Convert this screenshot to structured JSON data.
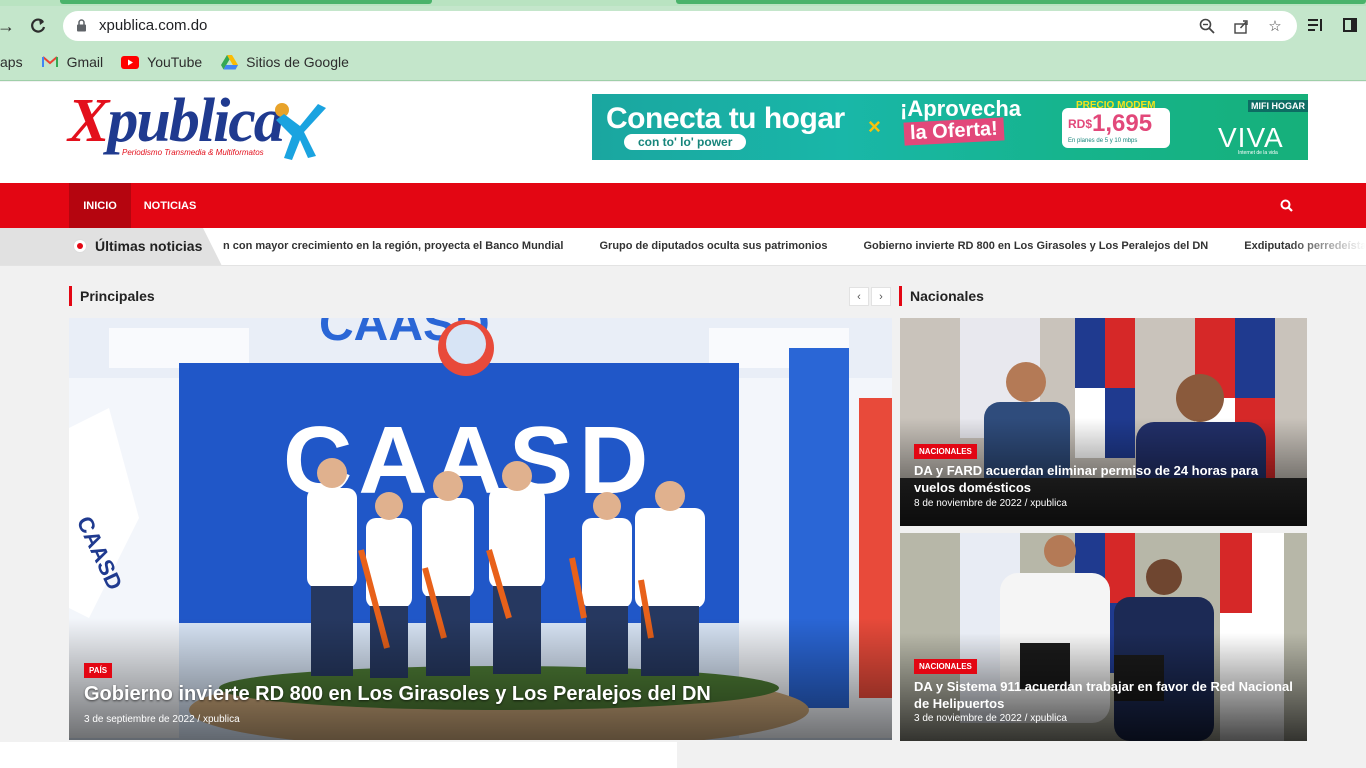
{
  "browser": {
    "url": "xpublica.com.do",
    "bookmarks": [
      {
        "label": "aps",
        "icon": "apps-icon"
      },
      {
        "label": "Gmail",
        "icon": "gmail-icon"
      },
      {
        "label": "YouTube",
        "icon": "youtube-icon"
      },
      {
        "label": "Sitios de Google",
        "icon": "google-drive-icon"
      }
    ]
  },
  "site": {
    "logo_x": "X",
    "logo_rest": "publica",
    "tagline": "Periodismo Transmedia & Multiformatos"
  },
  "ad": {
    "line1": "Conecta tu hogar",
    "line1_sub": "con to' lo' power",
    "line2": "¡Aprovecha",
    "line2b": "la Oferta!",
    "precio_label": "PRECIO MODEM",
    "currency": "RD$",
    "price": "1,695",
    "fine": "En planes de 5 y 10 mbps",
    "mifi": "MIFI HOGAR",
    "brand": "VIVA",
    "brand_sub": "Internet de la vida"
  },
  "nav": {
    "items": [
      "INICIO",
      "NOTICIAS"
    ],
    "active": "INICIO"
  },
  "ticker": {
    "label": "Últimas noticias",
    "items": [
      "n con mayor crecimiento en la región, proyecta el Banco Mundial",
      "Grupo de diputados oculta sus patrimonios",
      "Gobierno invierte RD 800 en Los Girasoles y Los Peralejos del DN",
      "Exdiputado perredeísta sa"
    ]
  },
  "principales": {
    "title": "Principales",
    "hero": {
      "category": "PAÍS",
      "title": "Gobierno invierte RD 800 en Los Girasoles y Los Peralejos del DN",
      "meta": "3 de septiembre de 2022 / xpublica",
      "sign_main": "CAASD",
      "sign_top": "CAASD",
      "flag_text": "CAASD"
    }
  },
  "nacionales": {
    "title": "Nacionales",
    "cards": [
      {
        "category": "NACIONALES",
        "title": "DA y FARD acuerdan eliminar permiso de 24 horas para vuelos domésticos",
        "meta": "8 de noviembre de 2022 / xpublica"
      },
      {
        "category": "NACIONALES",
        "title": "DA y Sistema 911 acuerdan trabajar en favor de Red Nacional de Helipuertos",
        "meta": "3 de noviembre de 2022 / xpublica"
      }
    ]
  },
  "colors": {
    "brand_red": "#e30613",
    "brand_blue": "#1f3a8f",
    "chrome_green": "#c4e6cb"
  }
}
